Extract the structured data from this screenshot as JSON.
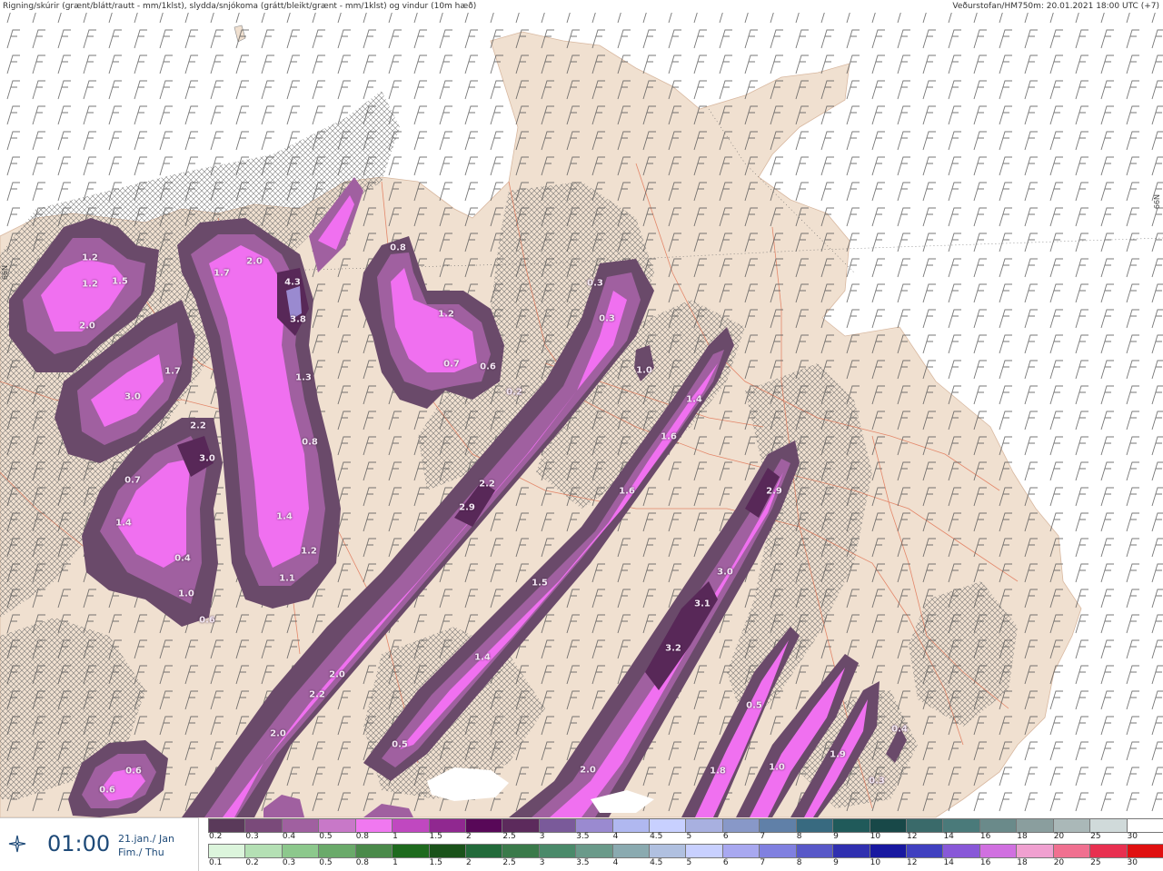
{
  "header": {
    "left": "Rigning/skúrir (grænt/blátt/rautt - mm/1klst), slydda/snjókoma (grátt/bleikt/grænt - mm/1klst) og vindur (10m hæð)",
    "right": "Veðurstofan/HM750m: 20.01.2021 18:00 UTC (+7)"
  },
  "latitude_labels": {
    "left": "66N",
    "right": "66N"
  },
  "time_panel": {
    "time": "01:00",
    "date_line1": "21.jan./ Jan",
    "date_line2": "Fim./ Thu",
    "icon": "compass-star-icon"
  },
  "legend_snow": {
    "labels": [
      "0.2",
      "0.3",
      "0.4",
      "0.5",
      "0.8",
      "1",
      "1.5",
      "2",
      "2.5",
      "3",
      "3.5",
      "4",
      "4.5",
      "5",
      "6",
      "7",
      "8",
      "9",
      "10",
      "12",
      "14",
      "16",
      "18",
      "20",
      "25",
      "30"
    ],
    "colors": [
      "#5a3a5a",
      "#7a4a7a",
      "#a060a0",
      "#c878c8",
      "#f078f0",
      "#c048c0",
      "#902890",
      "#580858",
      "#5c2a5c",
      "#7a5a9a",
      "#9a8ad0",
      "#b0b8f0",
      "#c8d0ff",
      "#a8b0e0",
      "#8898c8",
      "#6080a8",
      "#386a80",
      "#205a5a",
      "#184848",
      "#3a6a6a",
      "#4a7a7a",
      "#6a8a8a",
      "#8a9e9e",
      "#aab8b8",
      "#d0dada",
      "#ffffff"
    ]
  },
  "legend_rain": {
    "labels": [
      "0.1",
      "0.2",
      "0.3",
      "0.5",
      "0.8",
      "1",
      "1.5",
      "2",
      "2.5",
      "3",
      "3.5",
      "4",
      "4.5",
      "5",
      "6",
      "7",
      "8",
      "9",
      "10",
      "12",
      "14",
      "16",
      "18",
      "20",
      "25",
      "30"
    ],
    "colors": [
      "#dcf5dc",
      "#b4e0b4",
      "#8cc88c",
      "#6aaa6a",
      "#4a8a4a",
      "#1e6a1e",
      "#1a521a",
      "#226a3a",
      "#3a7a4a",
      "#4a8a6a",
      "#6a9a8a",
      "#8aaab0",
      "#b0c0e0",
      "#c8d0ff",
      "#a8a8f0",
      "#8080e0",
      "#5858c8",
      "#3030b0",
      "#1818a0",
      "#4040c0",
      "#8858d8",
      "#d070e0",
      "#f0a0d0",
      "#f07090",
      "#e83050",
      "#e01010"
    ]
  },
  "precip_values": [
    "1.2",
    "1.2",
    "1.5",
    "2.0",
    "1.7",
    "2.0",
    "4.3",
    "3.8",
    "3.0",
    "1.7",
    "1.3",
    "2.2",
    "3.0",
    "0.8",
    "0.7",
    "1.4",
    "1.4",
    "1.2",
    "0.4",
    "1.1",
    "1.0",
    "0.6",
    "0.8",
    "1.2",
    "0.7",
    "0.6",
    "0.2",
    "0.3",
    "1.0",
    "0.3",
    "1.4",
    "1.6",
    "2.2",
    "2.9",
    "1.6",
    "1.5",
    "2.9",
    "3.0",
    "3.1",
    "3.2",
    "1.4",
    "2.0",
    "2.2",
    "2.0",
    "0.5",
    "0.5",
    "1.8",
    "1.0",
    "1.9",
    "2.0",
    "0.6",
    "0.6",
    "0.4",
    "0.3"
  ],
  "colors": {
    "land": "#f0e0d0",
    "sea": "#ffffff",
    "snow_light": "#6a4a6a",
    "snow_mid": "#a060a0",
    "snow_bright": "#f070f0",
    "snow_dark": "#582858",
    "roads": "#e07050",
    "hatch": "#555555"
  }
}
